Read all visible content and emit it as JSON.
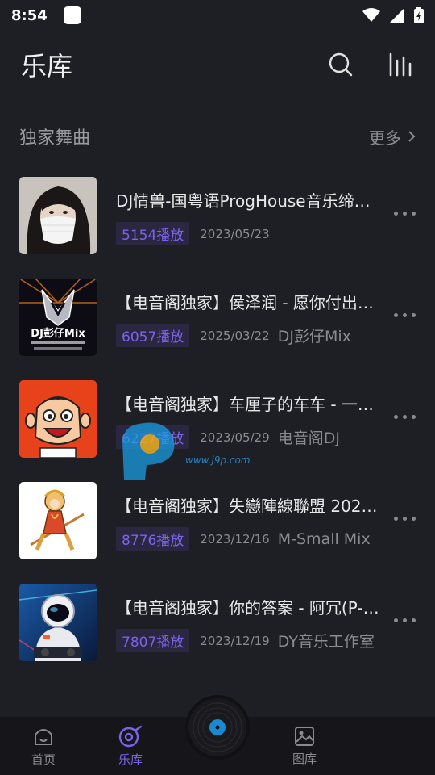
{
  "status": {
    "time": "8:54"
  },
  "header": {
    "title": "乐库"
  },
  "section": {
    "title": "独家舞曲",
    "more_label": "更多"
  },
  "songs": [
    {
      "title": "DJ情兽-国粤语ProgHouse音乐缔…",
      "plays": "5154播放",
      "date": "2023/05/23",
      "artist": ""
    },
    {
      "title": "【电音阁独家】侯泽润 - 愿你付出…",
      "plays": "6057播放",
      "date": "2025/03/22",
      "artist": "DJ彭仔Mix"
    },
    {
      "title": "【电音阁独家】车厘子的车车 - 一…",
      "plays": "6227播放",
      "date": "2023/05/29",
      "artist": "电音阁DJ"
    },
    {
      "title": "【电音阁独家】失戀陣線聯盟 202…",
      "plays": "8776播放",
      "date": "2023/12/16",
      "artist": "M-Small Mix"
    },
    {
      "title": "【电音阁独家】你的答案 - 阿冗(P-…",
      "plays": "7807播放",
      "date": "2023/12/19",
      "artist": "DY音乐工作室"
    }
  ],
  "covers": {
    "song2_caption": "DJ彭仔Mix"
  },
  "watermark": {
    "url": "www.j9p.com"
  },
  "nav": {
    "home": "首页",
    "library": "乐库",
    "gallery": "图库"
  },
  "colors": {
    "accent": "#7b63e8",
    "background": "#1e1f25"
  }
}
